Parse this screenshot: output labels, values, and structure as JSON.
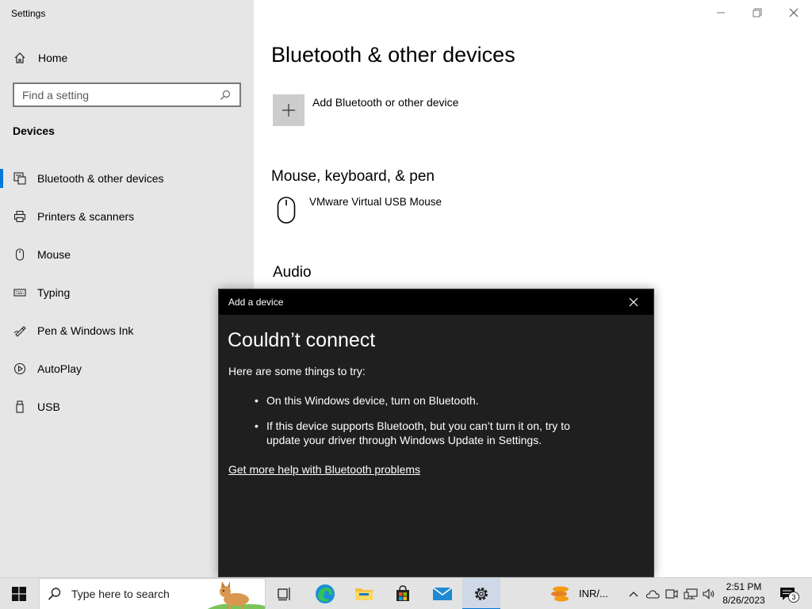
{
  "window": {
    "title": "Settings"
  },
  "sidebar": {
    "home_label": "Home",
    "search_placeholder": "Find a setting",
    "section": "Devices",
    "items": [
      {
        "label": "Bluetooth & other devices",
        "icon": "bluetooth-devices-icon",
        "active": true
      },
      {
        "label": "Printers & scanners",
        "icon": "printer-icon"
      },
      {
        "label": "Mouse",
        "icon": "mouse-icon"
      },
      {
        "label": "Typing",
        "icon": "keyboard-icon"
      },
      {
        "label": "Pen & Windows Ink",
        "icon": "pen-icon"
      },
      {
        "label": "AutoPlay",
        "icon": "autoplay-icon"
      },
      {
        "label": "USB",
        "icon": "usb-icon"
      }
    ]
  },
  "main": {
    "title": "Bluetooth & other devices",
    "add_device_label": "Add Bluetooth or other device",
    "mouse_section": "Mouse, keyboard, & pen",
    "mouse_device": "VMware Virtual USB Mouse",
    "audio_section": "Audio"
  },
  "dialog": {
    "title": "Add a device",
    "heading": "Couldn’t connect",
    "intro": "Here are some things to try:",
    "tips": [
      "On this Windows device, turn on Bluetooth.",
      "If this device supports Bluetooth, but you can’t turn it on, try to update your driver through Windows Update in Settings."
    ],
    "help_link": "Get more help with Bluetooth problems"
  },
  "taskbar": {
    "search_placeholder": "Type here to search",
    "tray_label": "INR/...",
    "time": "2:51 PM",
    "date": "8/26/2023",
    "notification_count": "3"
  },
  "colors": {
    "accent": "#0078d7",
    "sidebar_bg": "#e6e6e6",
    "dialog_bg": "#1f1f1f"
  }
}
